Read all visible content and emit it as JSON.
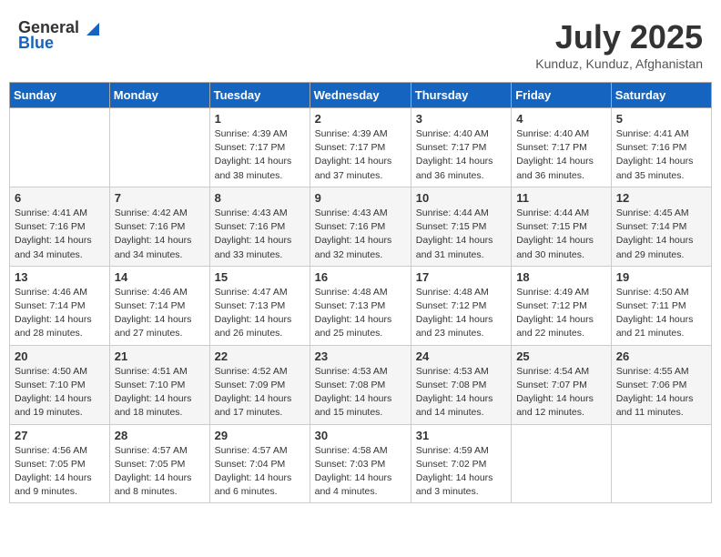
{
  "header": {
    "logo_general": "General",
    "logo_blue": "Blue",
    "month": "July 2025",
    "location": "Kunduz, Kunduz, Afghanistan"
  },
  "weekdays": [
    "Sunday",
    "Monday",
    "Tuesday",
    "Wednesday",
    "Thursday",
    "Friday",
    "Saturday"
  ],
  "weeks": [
    [
      {
        "day": "",
        "info": ""
      },
      {
        "day": "",
        "info": ""
      },
      {
        "day": "1",
        "info": "Sunrise: 4:39 AM\nSunset: 7:17 PM\nDaylight: 14 hours\nand 38 minutes."
      },
      {
        "day": "2",
        "info": "Sunrise: 4:39 AM\nSunset: 7:17 PM\nDaylight: 14 hours\nand 37 minutes."
      },
      {
        "day": "3",
        "info": "Sunrise: 4:40 AM\nSunset: 7:17 PM\nDaylight: 14 hours\nand 36 minutes."
      },
      {
        "day": "4",
        "info": "Sunrise: 4:40 AM\nSunset: 7:17 PM\nDaylight: 14 hours\nand 36 minutes."
      },
      {
        "day": "5",
        "info": "Sunrise: 4:41 AM\nSunset: 7:16 PM\nDaylight: 14 hours\nand 35 minutes."
      }
    ],
    [
      {
        "day": "6",
        "info": "Sunrise: 4:41 AM\nSunset: 7:16 PM\nDaylight: 14 hours\nand 34 minutes."
      },
      {
        "day": "7",
        "info": "Sunrise: 4:42 AM\nSunset: 7:16 PM\nDaylight: 14 hours\nand 34 minutes."
      },
      {
        "day": "8",
        "info": "Sunrise: 4:43 AM\nSunset: 7:16 PM\nDaylight: 14 hours\nand 33 minutes."
      },
      {
        "day": "9",
        "info": "Sunrise: 4:43 AM\nSunset: 7:16 PM\nDaylight: 14 hours\nand 32 minutes."
      },
      {
        "day": "10",
        "info": "Sunrise: 4:44 AM\nSunset: 7:15 PM\nDaylight: 14 hours\nand 31 minutes."
      },
      {
        "day": "11",
        "info": "Sunrise: 4:44 AM\nSunset: 7:15 PM\nDaylight: 14 hours\nand 30 minutes."
      },
      {
        "day": "12",
        "info": "Sunrise: 4:45 AM\nSunset: 7:14 PM\nDaylight: 14 hours\nand 29 minutes."
      }
    ],
    [
      {
        "day": "13",
        "info": "Sunrise: 4:46 AM\nSunset: 7:14 PM\nDaylight: 14 hours\nand 28 minutes."
      },
      {
        "day": "14",
        "info": "Sunrise: 4:46 AM\nSunset: 7:14 PM\nDaylight: 14 hours\nand 27 minutes."
      },
      {
        "day": "15",
        "info": "Sunrise: 4:47 AM\nSunset: 7:13 PM\nDaylight: 14 hours\nand 26 minutes."
      },
      {
        "day": "16",
        "info": "Sunrise: 4:48 AM\nSunset: 7:13 PM\nDaylight: 14 hours\nand 25 minutes."
      },
      {
        "day": "17",
        "info": "Sunrise: 4:48 AM\nSunset: 7:12 PM\nDaylight: 14 hours\nand 23 minutes."
      },
      {
        "day": "18",
        "info": "Sunrise: 4:49 AM\nSunset: 7:12 PM\nDaylight: 14 hours\nand 22 minutes."
      },
      {
        "day": "19",
        "info": "Sunrise: 4:50 AM\nSunset: 7:11 PM\nDaylight: 14 hours\nand 21 minutes."
      }
    ],
    [
      {
        "day": "20",
        "info": "Sunrise: 4:50 AM\nSunset: 7:10 PM\nDaylight: 14 hours\nand 19 minutes."
      },
      {
        "day": "21",
        "info": "Sunrise: 4:51 AM\nSunset: 7:10 PM\nDaylight: 14 hours\nand 18 minutes."
      },
      {
        "day": "22",
        "info": "Sunrise: 4:52 AM\nSunset: 7:09 PM\nDaylight: 14 hours\nand 17 minutes."
      },
      {
        "day": "23",
        "info": "Sunrise: 4:53 AM\nSunset: 7:08 PM\nDaylight: 14 hours\nand 15 minutes."
      },
      {
        "day": "24",
        "info": "Sunrise: 4:53 AM\nSunset: 7:08 PM\nDaylight: 14 hours\nand 14 minutes."
      },
      {
        "day": "25",
        "info": "Sunrise: 4:54 AM\nSunset: 7:07 PM\nDaylight: 14 hours\nand 12 minutes."
      },
      {
        "day": "26",
        "info": "Sunrise: 4:55 AM\nSunset: 7:06 PM\nDaylight: 14 hours\nand 11 minutes."
      }
    ],
    [
      {
        "day": "27",
        "info": "Sunrise: 4:56 AM\nSunset: 7:05 PM\nDaylight: 14 hours\nand 9 minutes."
      },
      {
        "day": "28",
        "info": "Sunrise: 4:57 AM\nSunset: 7:05 PM\nDaylight: 14 hours\nand 8 minutes."
      },
      {
        "day": "29",
        "info": "Sunrise: 4:57 AM\nSunset: 7:04 PM\nDaylight: 14 hours\nand 6 minutes."
      },
      {
        "day": "30",
        "info": "Sunrise: 4:58 AM\nSunset: 7:03 PM\nDaylight: 14 hours\nand 4 minutes."
      },
      {
        "day": "31",
        "info": "Sunrise: 4:59 AM\nSunset: 7:02 PM\nDaylight: 14 hours\nand 3 minutes."
      },
      {
        "day": "",
        "info": ""
      },
      {
        "day": "",
        "info": ""
      }
    ]
  ]
}
